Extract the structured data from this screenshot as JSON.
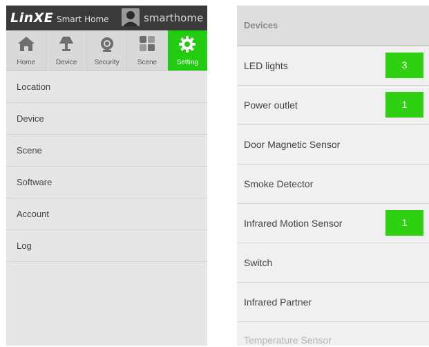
{
  "left": {
    "brand": "LinXE",
    "brand_sub": "Smart Home",
    "username": "smarthome",
    "tabs": [
      {
        "label": "Home",
        "icon": "home-icon",
        "active": false
      },
      {
        "label": "Device",
        "icon": "lamp-icon",
        "active": false
      },
      {
        "label": "Security",
        "icon": "camera-icon",
        "active": false
      },
      {
        "label": "Scene",
        "icon": "scene-icon",
        "active": false
      },
      {
        "label": "Setting",
        "icon": "gear-icon",
        "active": true
      }
    ],
    "menu": [
      {
        "label": "Location"
      },
      {
        "label": "Device"
      },
      {
        "label": "Scene"
      },
      {
        "label": "Software"
      },
      {
        "label": "Account"
      },
      {
        "label": "Log"
      }
    ]
  },
  "right": {
    "header": "Devices",
    "devices": [
      {
        "name": "LED lights",
        "count": "3"
      },
      {
        "name": "Power outlet",
        "count": "1"
      },
      {
        "name": "Door Magnetic Sensor",
        "count": ""
      },
      {
        "name": "Smoke Detector",
        "count": ""
      },
      {
        "name": "Infrared Motion Sensor",
        "count": "1"
      },
      {
        "name": "Switch",
        "count": ""
      },
      {
        "name": "Infrared Partner",
        "count": ""
      },
      {
        "name": "Temperature Sensor",
        "count": ""
      }
    ]
  },
  "colors": {
    "accent_green": "#22cc11",
    "badge_green": "#2fd012",
    "topbar": "#3a3a3a"
  }
}
